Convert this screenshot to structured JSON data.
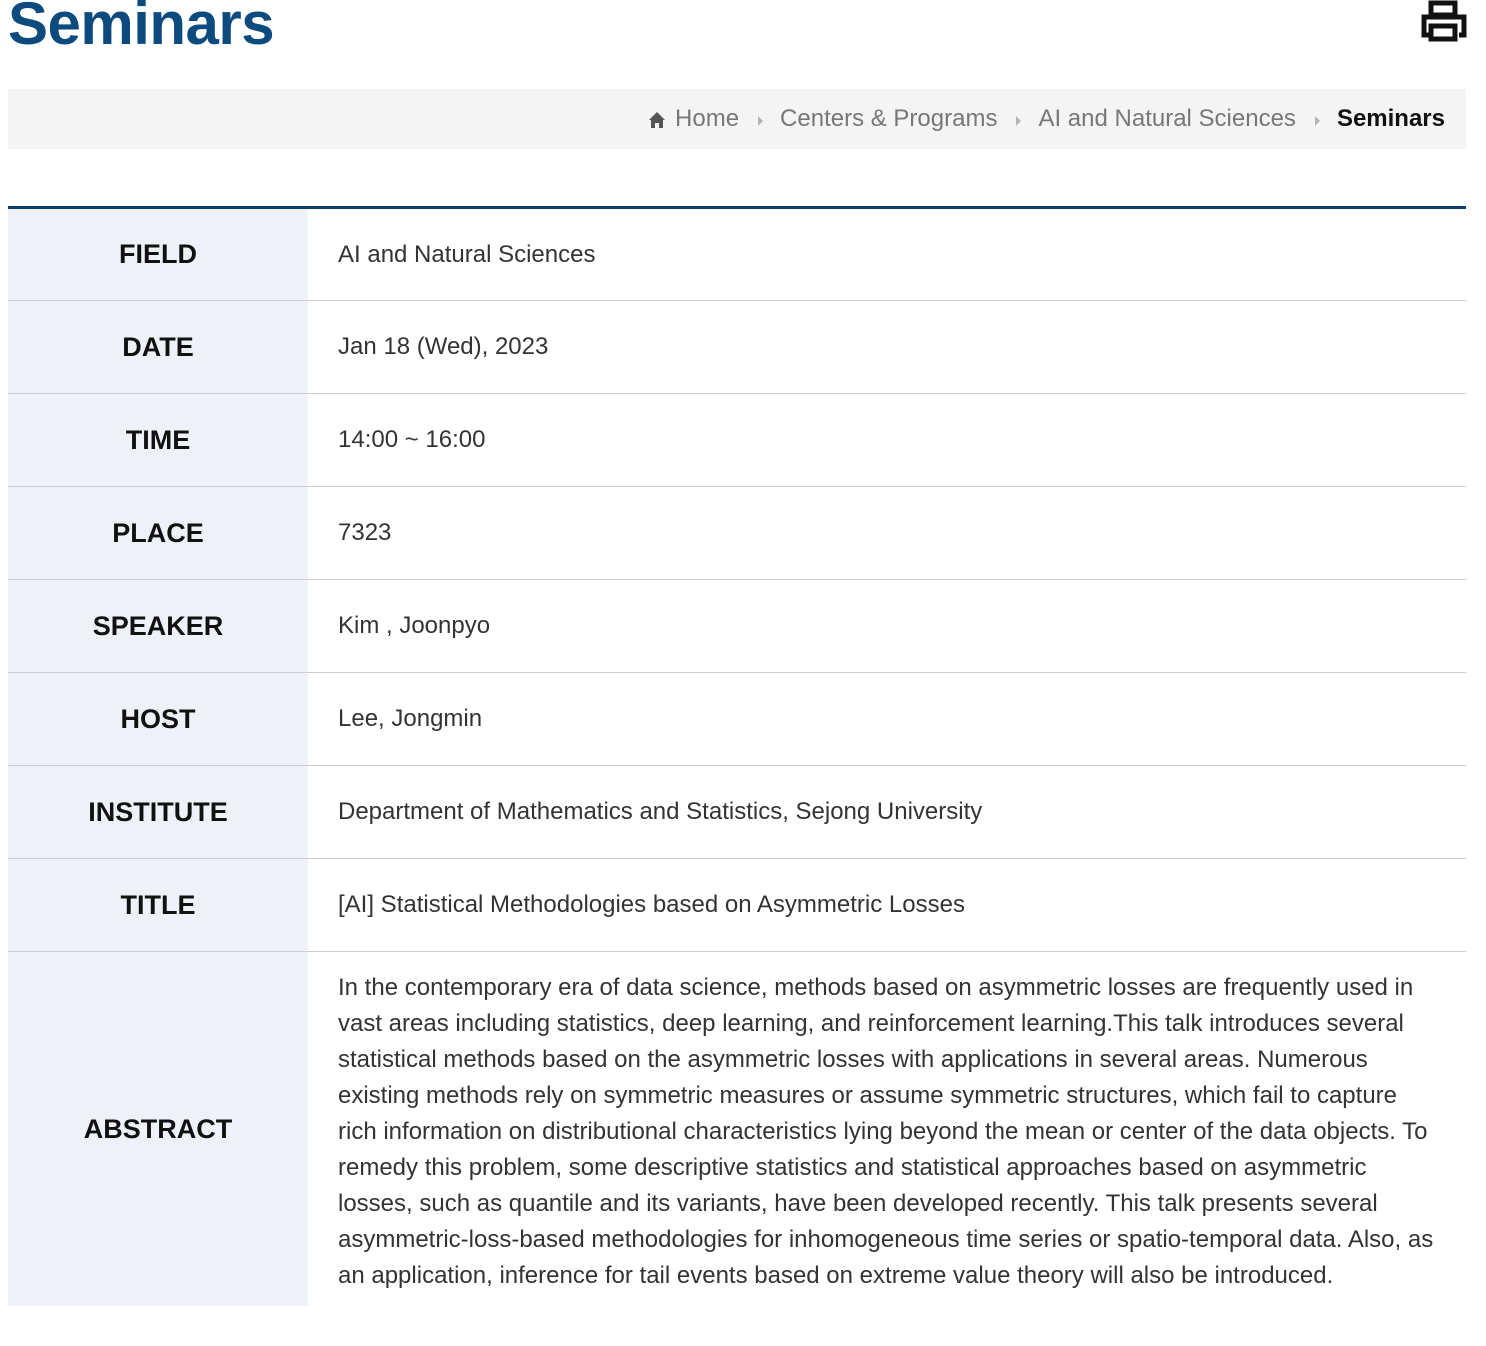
{
  "page": {
    "title": "Seminars"
  },
  "toolbar": {
    "print_icon": "printer-icon"
  },
  "breadcrumb": {
    "home_icon": "home-icon",
    "items": [
      {
        "label": "Home"
      },
      {
        "label": "Centers & Programs"
      },
      {
        "label": "AI and Natural Sciences"
      },
      {
        "label": "Seminars"
      }
    ]
  },
  "seminar": {
    "rows": [
      {
        "label": "FIELD",
        "value": "AI and Natural Sciences"
      },
      {
        "label": "DATE",
        "value": "Jan 18 (Wed), 2023"
      },
      {
        "label": "TIME",
        "value": "14:00 ~ 16:00"
      },
      {
        "label": "PLACE",
        "value": "7323"
      },
      {
        "label": "SPEAKER",
        "value": "Kim , Joonpyo"
      },
      {
        "label": "HOST",
        "value": "Lee, Jongmin"
      },
      {
        "label": "INSTITUTE",
        "value": "Department of Mathematics and Statistics, Sejong University"
      },
      {
        "label": "TITLE",
        "value": "[AI] Statistical Methodologies based on Asymmetric Losses"
      },
      {
        "label": "ABSTRACT",
        "value": "In the contemporary era of data science, methods based on asymmetric losses are frequently used in vast areas including statistics, deep learning, and reinforcement learning.This talk introduces several statistical methods based on the asymmetric losses with applications in several areas. Numerous existing methods rely on symmetric measures or assume symmetric structures, which fail to capture rich information on distributional characteristics lying beyond the mean or center of the data objects. To remedy this problem, some descriptive statistics and statistical approaches based on asymmetric losses, such as quantile and its variants, have been developed recently. This talk presents several asymmetric-loss-based methodologies for inhomogeneous time series or spatio-temporal data. Also, as an application, inference for tail events based on extreme value theory will also be introduced."
      }
    ]
  },
  "colors": {
    "title": "#0d4a7e",
    "table_border_top": "#0d3d6b",
    "label_background": "#eef2f8",
    "breadcrumb_background": "#f4f4f4"
  }
}
